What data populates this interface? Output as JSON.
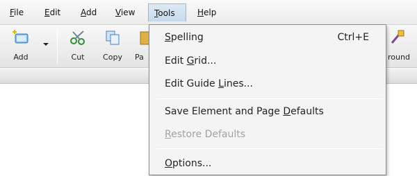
{
  "menubar": {
    "items": [
      {
        "label": "File",
        "underline": "F"
      },
      {
        "label": "Edit",
        "underline": "E"
      },
      {
        "label": "Add",
        "underline": "A"
      },
      {
        "label": "View",
        "underline": "V"
      },
      {
        "label": "Tools",
        "underline": "T"
      },
      {
        "label": "Help",
        "underline": "H"
      }
    ]
  },
  "toolbar": {
    "add_label": "Add",
    "cut_label": "Cut",
    "copy_label": "Copy",
    "paste_label_partial": "Pa",
    "background_label_partial": "round"
  },
  "tools_menu": {
    "items": [
      {
        "pre": "",
        "u": "S",
        "post": "pelling",
        "shortcut": "Ctrl+E",
        "disabled": false
      },
      {
        "pre": "Edit ",
        "u": "G",
        "post": "rid...",
        "shortcut": "",
        "disabled": false
      },
      {
        "pre": "Edit Guide ",
        "u": "L",
        "post": "ines...",
        "shortcut": "",
        "disabled": false
      },
      {
        "pre": "Save Element and Page ",
        "u": "D",
        "post": "efaults",
        "shortcut": "",
        "disabled": false
      },
      {
        "pre": "",
        "u": "R",
        "post": "estore Defaults",
        "shortcut": "",
        "disabled": true
      },
      {
        "pre": "",
        "u": "O",
        "post": "ptions...",
        "shortcut": "",
        "disabled": false
      }
    ]
  },
  "colors": {
    "menu_active": "#c6d9ec",
    "disabled_text": "#a2a2a2",
    "add_icon": "#4a90d9",
    "cut_icon": "#3a9a3a",
    "copy_icon": "#5b8fc7"
  }
}
